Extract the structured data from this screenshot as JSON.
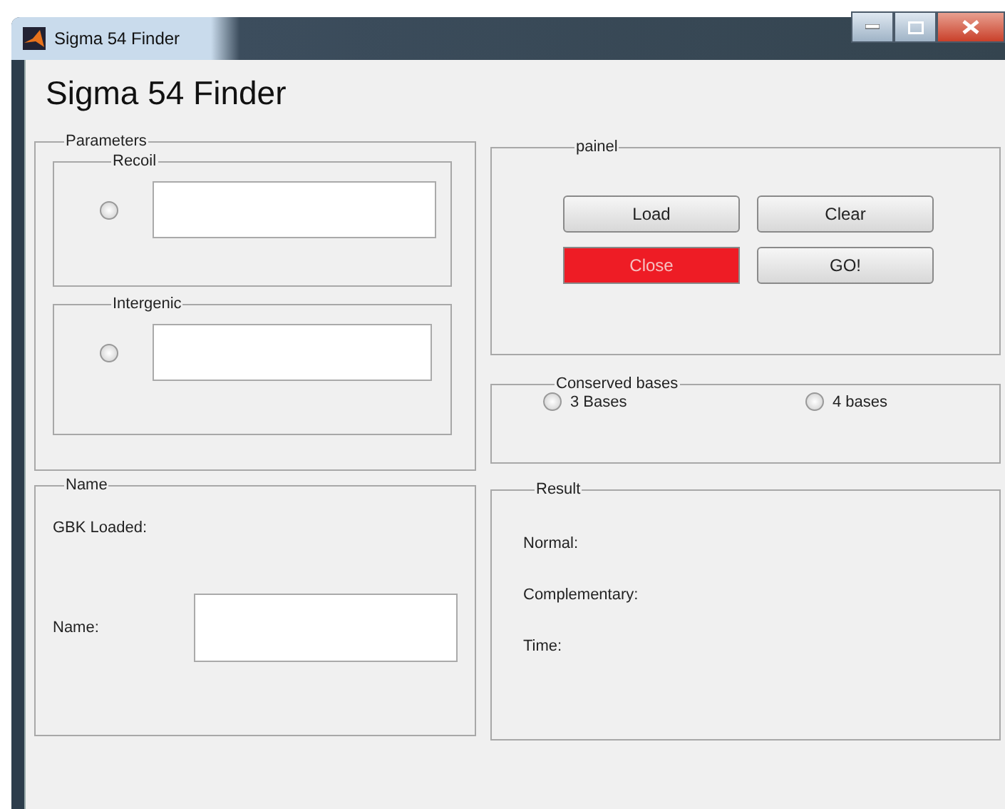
{
  "window": {
    "title": "Sigma 54 Finder"
  },
  "heading": "Sigma 54 Finder",
  "parameters": {
    "title": "Parameters",
    "groups": [
      {
        "title": "Recoil",
        "radio_selected": false
      },
      {
        "title": "Intergenic",
        "radio_selected": false
      }
    ]
  },
  "painel": {
    "title": "painel",
    "buttons": [
      {
        "label": "Load",
        "kind": "normal"
      },
      {
        "label": "Clear",
        "kind": "normal"
      },
      {
        "label": "Close",
        "kind": "danger"
      },
      {
        "label": "GO!",
        "kind": "normal"
      }
    ]
  },
  "conserved_bases": {
    "title": "Conserved bases",
    "options": [
      {
        "label": "3 Bases",
        "selected": false
      },
      {
        "label": "4 bases",
        "selected": false
      }
    ]
  },
  "name_panel": {
    "title": "Name",
    "gbk_label": "GBK Loaded:",
    "name_label": "Name:"
  },
  "result": {
    "title": "Result",
    "labels": [
      "Normal:",
      "Complementary:",
      "Time:"
    ]
  }
}
